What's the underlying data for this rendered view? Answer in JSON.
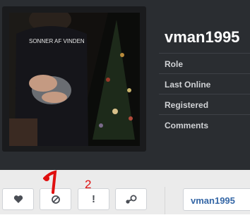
{
  "profile": {
    "username": "vman1995",
    "avatar_shirt_text": "SONNER AF VINDEN",
    "info_labels": [
      "Role",
      "Last Online",
      "Registered",
      "Comments"
    ]
  },
  "actions": {
    "buttons": [
      {
        "icon": "heart-icon"
      },
      {
        "icon": "block-icon"
      },
      {
        "icon": "report-icon",
        "glyph": "!"
      },
      {
        "icon": "steam-icon"
      }
    ],
    "name_button_label": "vman1995"
  },
  "annotations": {
    "mark_1": "1",
    "mark_2": "2"
  },
  "colors": {
    "annotation": "#e01010",
    "link": "#3567a6",
    "header_bg": "#2a2d31"
  }
}
